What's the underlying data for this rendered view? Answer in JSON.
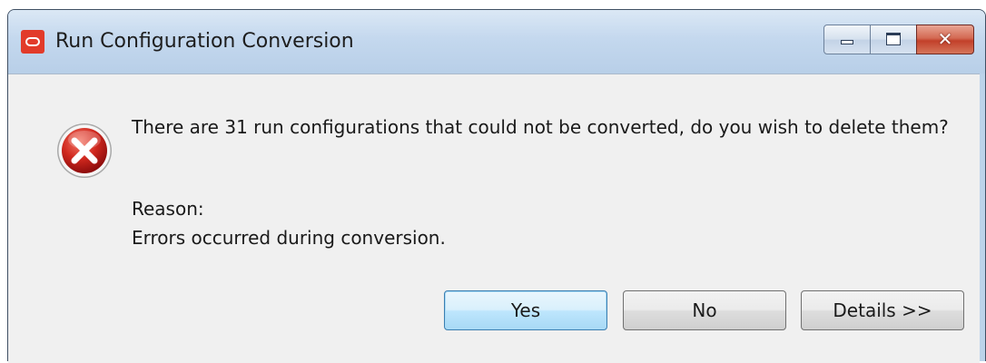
{
  "window": {
    "title": "Run Configuration Conversion",
    "icon": "oracle-logo-icon",
    "controls": {
      "minimize_icon": "minimize-icon",
      "maximize_icon": "maximize-icon",
      "close_glyph": "✕"
    }
  },
  "dialog": {
    "icon": "error-icon",
    "message": "There are 31 run configurations that could not be converted, do you wish to delete them?",
    "reason_label": "Reason:",
    "reason_text": "Errors occurred during conversion.",
    "buttons": {
      "yes": "Yes",
      "no": "No",
      "details": "Details >>"
    }
  },
  "colors": {
    "accent_default_button": "#3c7fb1",
    "error_red": "#c0161b",
    "app_icon_red": "#e23b2a"
  }
}
